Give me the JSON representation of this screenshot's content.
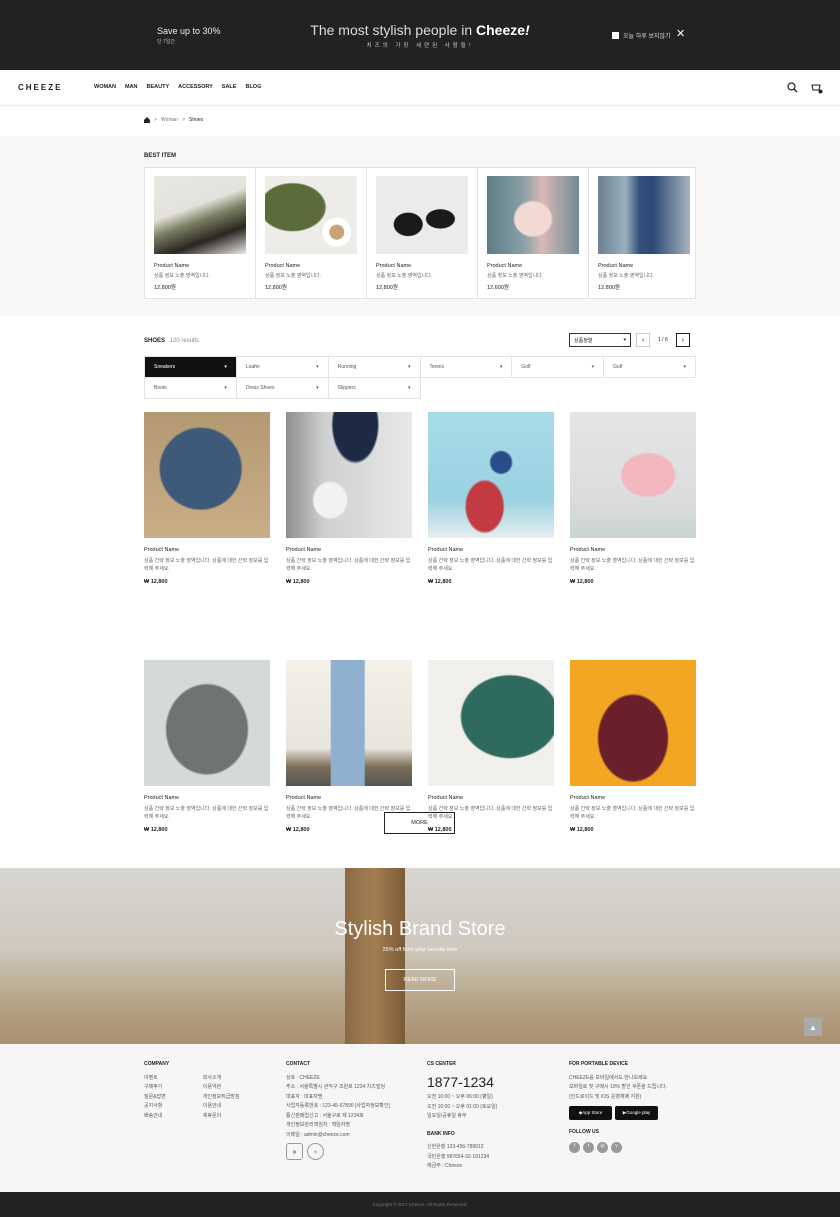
{
  "topbar": {
    "promo_title": "Save up to 30%",
    "promo_sub": "단 7일간",
    "headline_pre": "The most stylish people in ",
    "headline_brand": "Cheeze",
    "headline_excl": "!",
    "headline_ko": "치즈의 가장 세련된 사람들!",
    "dont_show_label": "오늘 하루 보지않기",
    "close": "✕"
  },
  "header": {
    "logo": "CHEEZE",
    "nav": [
      "WOMAN",
      "MAN",
      "BEAUTY",
      "ACCESSORY",
      "SALE",
      "BLOG"
    ]
  },
  "breadcrumb": [
    "Woman",
    "Shoes"
  ],
  "best": {
    "title": "BEST ITEM",
    "items": [
      {
        "name": "Product Name",
        "desc": "상품 정보 노출 영역입니다.",
        "price": "12,800원"
      },
      {
        "name": "Product Name",
        "desc": "상품 정보 노출 영역입니다.",
        "price": "12,800원"
      },
      {
        "name": "Product Name",
        "desc": "상품 정보 노출 영역입니다.",
        "price": "12,800원"
      },
      {
        "name": "Product Name",
        "desc": "상품 정보 노출 영역입니다.",
        "price": "12,600원"
      },
      {
        "name": "Product Name",
        "desc": "상품 정보 노출 영역입니다.",
        "price": "12,800원"
      }
    ]
  },
  "listing": {
    "title": "SHOES",
    "count": "120 results",
    "sort": "상품정렬",
    "page": "1 / 6",
    "filters": [
      "Sneakers",
      "Loafer",
      "Running",
      "Tennis",
      "Golf",
      "Golf",
      "Boots",
      "Dress Shoes",
      "Slippers"
    ],
    "products": [
      {
        "name": "Product Name",
        "desc": "상품 간략 정보 노출 영역입니다. 상품에 대한 간략 정보를 입력해 주세요.",
        "price": "₩ 12,800"
      },
      {
        "name": "Product Name",
        "desc": "상품 간략 정보 노출 영역입니다. 상품에 대한 간략 정보를 입력해 주세요.",
        "price": "₩ 12,800"
      },
      {
        "name": "Product Name",
        "desc": "상품 간략 정보 노출 영역입니다. 상품에 대한 간략 정보를 입력해 주세요.",
        "price": "₩ 12,800"
      },
      {
        "name": "Product Name",
        "desc": "상품 간략 정보 노출 영역입니다. 상품에 대한 간략 정보를 입력해 주세요.",
        "price": "₩ 12,800"
      },
      {
        "name": "Product Name",
        "desc": "상품 간략 정보 노출 영역입니다. 상품에 대한 간략 정보를 입력해 주세요.",
        "price": "₩ 12,800"
      },
      {
        "name": "Product Name",
        "desc": "상품 간략 정보 노출 영역입니다. 상품에 대한 간략 정보를 입력해 주세요.",
        "price": "₩ 12,800"
      },
      {
        "name": "Product Name",
        "desc": "상품 간략 정보 노출 영역입니다. 상품에 대한 간략 정보를 입력해 주세요.",
        "price": "₩ 12,800"
      },
      {
        "name": "Product Name",
        "desc": "상품 간략 정보 노출 영역입니다. 상품에 대한 간략 정보를 입력해 주세요.",
        "price": "₩ 12,800"
      }
    ],
    "more": "MORE"
  },
  "banner": {
    "title": "Stylish Brand Store",
    "sub": "25% off from your favorite item",
    "button": "READ MORE"
  },
  "footer": {
    "company_title": "COMPANY",
    "company_links_a": [
      "이벤트",
      "구매후기",
      "질문&답변",
      "공지사항",
      "배송안내"
    ],
    "company_links_b": [
      "회사소개",
      "이용약관",
      "개인정보취급방침",
      "이용안내",
      "제휴문의"
    ],
    "contact_title": "CONTACT",
    "contact_lines": [
      "상호 : CHEEZE",
      "주소 : 서울특별시 관악구 조원로 1234 치즈빌딩",
      "대표자 : 대표자명",
      "사업자등록번호 : 123-45-67890 [사업자정보확인]",
      "통신판매업신고 : 서울구로 제 1234호",
      "개인정보관리책임자 : 책임자명",
      "이메일 : admin@cheeze.com"
    ],
    "cs_title": "CS CENTER",
    "cs_phone": "1877-1234",
    "cs_lines": [
      "오전 10:00 ~ 오후 06:00 (평일)",
      "오전 10:00 ~ 오후 01:00 (토요일)",
      "일요일/공휴일 휴무"
    ],
    "bank_title": "BANK INFO",
    "bank_lines": [
      "신한은행    123-456-789012",
      "국민은행    987654-32-101234",
      "예금주 : Cheeze"
    ],
    "device_title": "FOR PORTABLE DEVICE",
    "device_lines": [
      "CHEEZE를 모바일에서도 만나보세요.",
      "모바일로 첫 구매시 10% 할인 쿠폰을 드립니다.",
      "(안드로이드 및 iOS 운영체제 지원)"
    ],
    "appstore": "App Store",
    "googleplay": "Google play",
    "follow_title": "FOLLOW US",
    "copyright": "Copyright © 2017 Cheeze. All Rights Reserved."
  }
}
